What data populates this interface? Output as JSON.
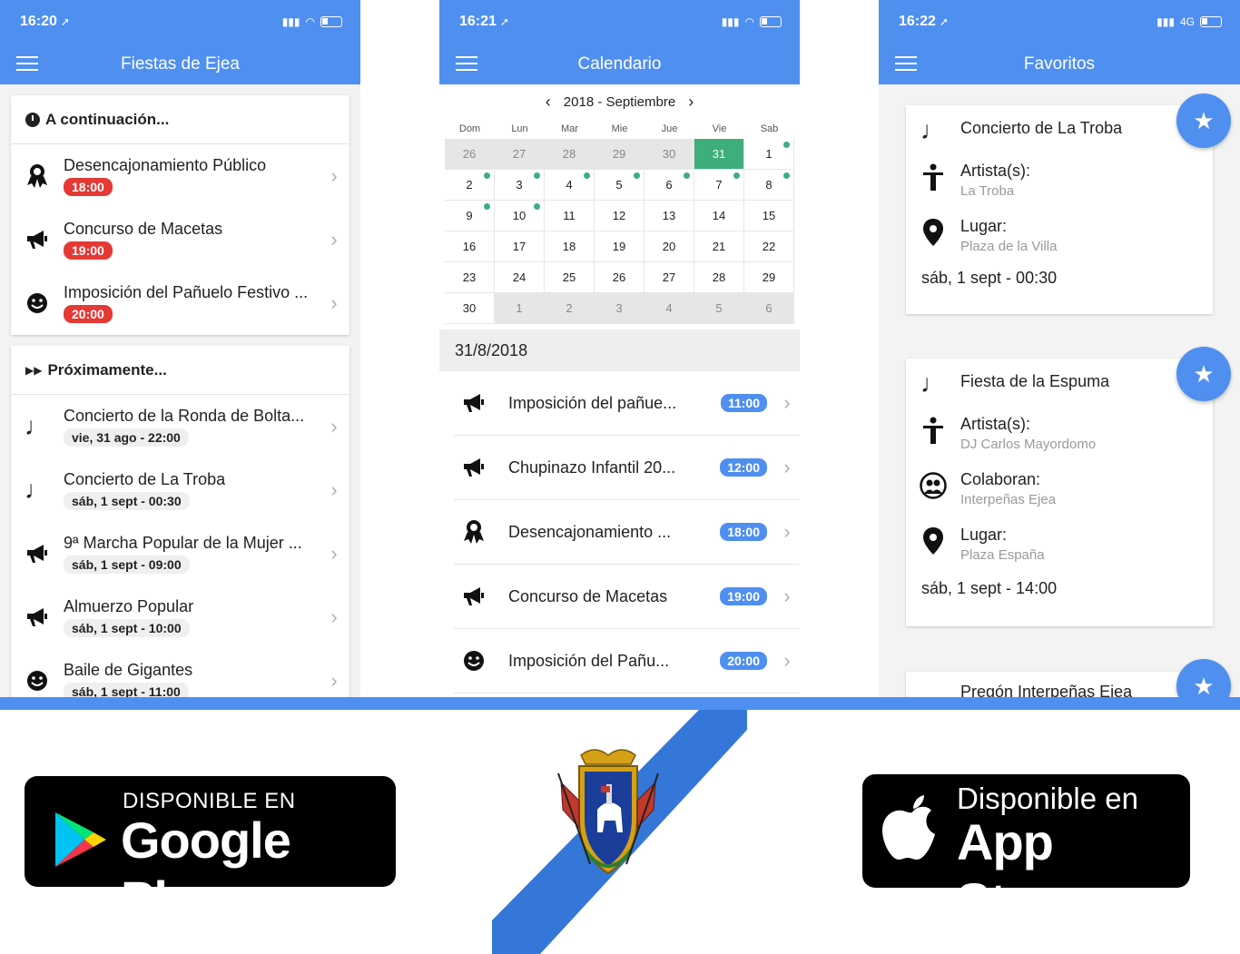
{
  "screen1": {
    "status": {
      "time": "16:20"
    },
    "title": "Fiestas de Ejea",
    "next_section": {
      "header": "A continuación...",
      "events": [
        {
          "title": "Desencajonamiento Público",
          "time": "18:00",
          "icon": "ribbon-icon"
        },
        {
          "title": "Concurso de Macetas",
          "time": "19:00",
          "icon": "megaphone-icon"
        },
        {
          "title": "Imposición del Pañuelo Festivo ...",
          "time": "20:00",
          "icon": "smiley-icon"
        }
      ]
    },
    "upcoming_section": {
      "header": "Próximamente...",
      "events": [
        {
          "title": "Concierto de la Ronda de Bolta...",
          "date": "vie, 31 ago - 22:00",
          "icon": "music-note-icon"
        },
        {
          "title": "Concierto de La Troba",
          "date": "sáb, 1 sept - 00:30",
          "icon": "music-note-icon"
        },
        {
          "title": "9ª Marcha Popular de la Mujer ...",
          "date": "sáb, 1 sept - 09:00",
          "icon": "megaphone-icon"
        },
        {
          "title": "Almuerzo Popular",
          "date": "sáb, 1 sept - 10:00",
          "icon": "megaphone-icon"
        },
        {
          "title": "Baile de Gigantes",
          "date": "sáb, 1 sept - 11:00",
          "icon": "smiley-icon"
        }
      ]
    }
  },
  "screen2": {
    "status": {
      "time": "16:21"
    },
    "title": "Calendario",
    "month_label": "2018 - Septiembre",
    "weekdays": [
      "Dom",
      "Lun",
      "Mar",
      "Mie",
      "Jue",
      "Vie",
      "Sab"
    ],
    "days": [
      {
        "d": "26",
        "other": true
      },
      {
        "d": "27",
        "other": true
      },
      {
        "d": "28",
        "other": true
      },
      {
        "d": "29",
        "other": true
      },
      {
        "d": "30",
        "other": true
      },
      {
        "d": "31",
        "other": true,
        "selected": true
      },
      {
        "d": "1",
        "dot": true
      },
      {
        "d": "2",
        "dot": true
      },
      {
        "d": "3",
        "dot": true
      },
      {
        "d": "4",
        "dot": true
      },
      {
        "d": "5",
        "dot": true
      },
      {
        "d": "6",
        "dot": true
      },
      {
        "d": "7",
        "dot": true
      },
      {
        "d": "8",
        "dot": true
      },
      {
        "d": "9",
        "dot": true
      },
      {
        "d": "10",
        "dot": true
      },
      {
        "d": "11"
      },
      {
        "d": "12"
      },
      {
        "d": "13"
      },
      {
        "d": "14"
      },
      {
        "d": "15"
      },
      {
        "d": "16"
      },
      {
        "d": "17"
      },
      {
        "d": "18"
      },
      {
        "d": "19"
      },
      {
        "d": "20"
      },
      {
        "d": "21"
      },
      {
        "d": "22"
      },
      {
        "d": "23"
      },
      {
        "d": "24"
      },
      {
        "d": "25"
      },
      {
        "d": "26"
      },
      {
        "d": "27"
      },
      {
        "d": "28"
      },
      {
        "d": "29"
      },
      {
        "d": "30"
      },
      {
        "d": "1",
        "other": true
      },
      {
        "d": "2",
        "other": true
      },
      {
        "d": "3",
        "other": true
      },
      {
        "d": "4",
        "other": true
      },
      {
        "d": "5",
        "other": true
      },
      {
        "d": "6",
        "other": true
      }
    ],
    "selected_date": "31/8/2018",
    "events": [
      {
        "title": "Imposición del pañue...",
        "time": "11:00",
        "icon": "megaphone-icon"
      },
      {
        "title": "Chupinazo Infantil 20...",
        "time": "12:00",
        "icon": "megaphone-icon"
      },
      {
        "title": "Desencajonamiento ...",
        "time": "18:00",
        "icon": "ribbon-icon"
      },
      {
        "title": "Concurso de Macetas",
        "time": "19:00",
        "icon": "megaphone-icon"
      },
      {
        "title": "Imposición del Pañu...",
        "time": "20:00",
        "icon": "smiley-icon"
      }
    ]
  },
  "screen3": {
    "status": {
      "time": "16:22",
      "network": "4G"
    },
    "title": "Favoritos",
    "favorites": [
      {
        "title": "Concierto de La Troba",
        "artist_label": "Artista(s):",
        "artist": "La Troba",
        "place_label": "Lugar:",
        "place": "Plaza de la Villa",
        "datetime": "sáb, 1 sept - 00:30"
      },
      {
        "title": "Fiesta de la Espuma",
        "artist_label": "Artista(s):",
        "artist": "DJ Carlos Mayordomo",
        "collab_label": "Colaboran:",
        "collab": "Interpeñas Ejea",
        "place_label": "Lugar:",
        "place": "Plaza España",
        "datetime": "sáb, 1 sept - 14:00"
      },
      {
        "title": "Pregón Interpeñas Ejea"
      }
    ],
    "star_glyph": "★"
  },
  "badges": {
    "google_play": {
      "small": "DISPONIBLE EN",
      "big": "Google Play"
    },
    "app_store": {
      "small": "Disponible en",
      "big": "App Store"
    }
  },
  "colors": {
    "primary": "#4f8ff0",
    "accent_green": "#3dae7c",
    "time_red": "#e53935"
  }
}
